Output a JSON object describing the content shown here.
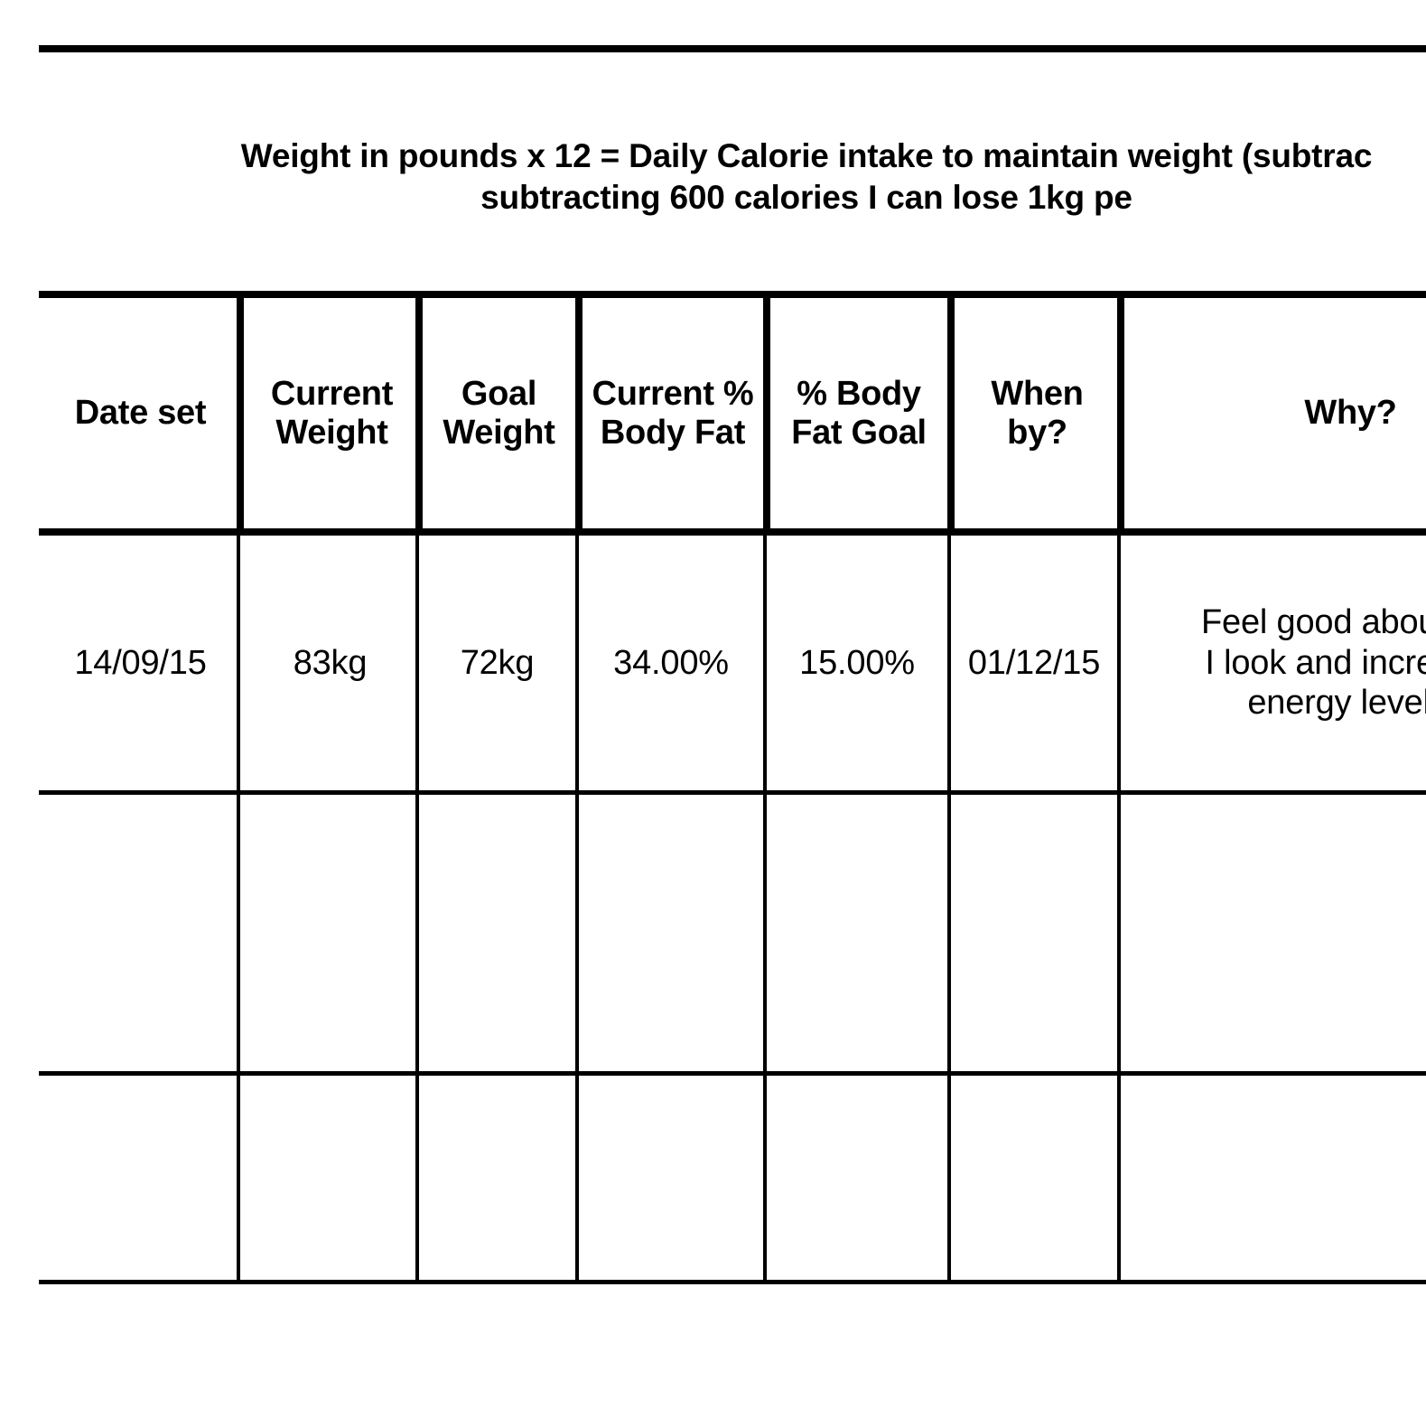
{
  "document": {
    "kind": "weight-goal-worksheet",
    "note": "Weight in pounds x 12 = Daily Calorie intake to maintain weight (subtrac\nsubtracting 600 calories I can lose 1kg pe"
  },
  "table": {
    "headers": [
      "Date set",
      "Current Weight",
      "Goal Weight",
      "Current % Body Fat",
      "% Body Fat Goal",
      "When by?",
      "Why?"
    ],
    "rows": [
      {
        "date_set": "14/09/15",
        "current_weight": "83kg",
        "goal_weight": "72kg",
        "current_body_fat": "34.00%",
        "body_fat_goal": "15.00%",
        "when_by": "01/12/15",
        "why": "Feel good about ho\nI look and increase\nenergy levels"
      },
      {
        "date_set": "",
        "current_weight": "",
        "goal_weight": "",
        "current_body_fat": "",
        "body_fat_goal": "",
        "when_by": "",
        "why": ""
      },
      {
        "date_set": "",
        "current_weight": "",
        "goal_weight": "",
        "current_body_fat": "",
        "body_fat_goal": "",
        "when_by": "",
        "why": ""
      }
    ]
  },
  "colors": {
    "rule": "#000000",
    "text": "#000000",
    "background": "#ffffff"
  }
}
